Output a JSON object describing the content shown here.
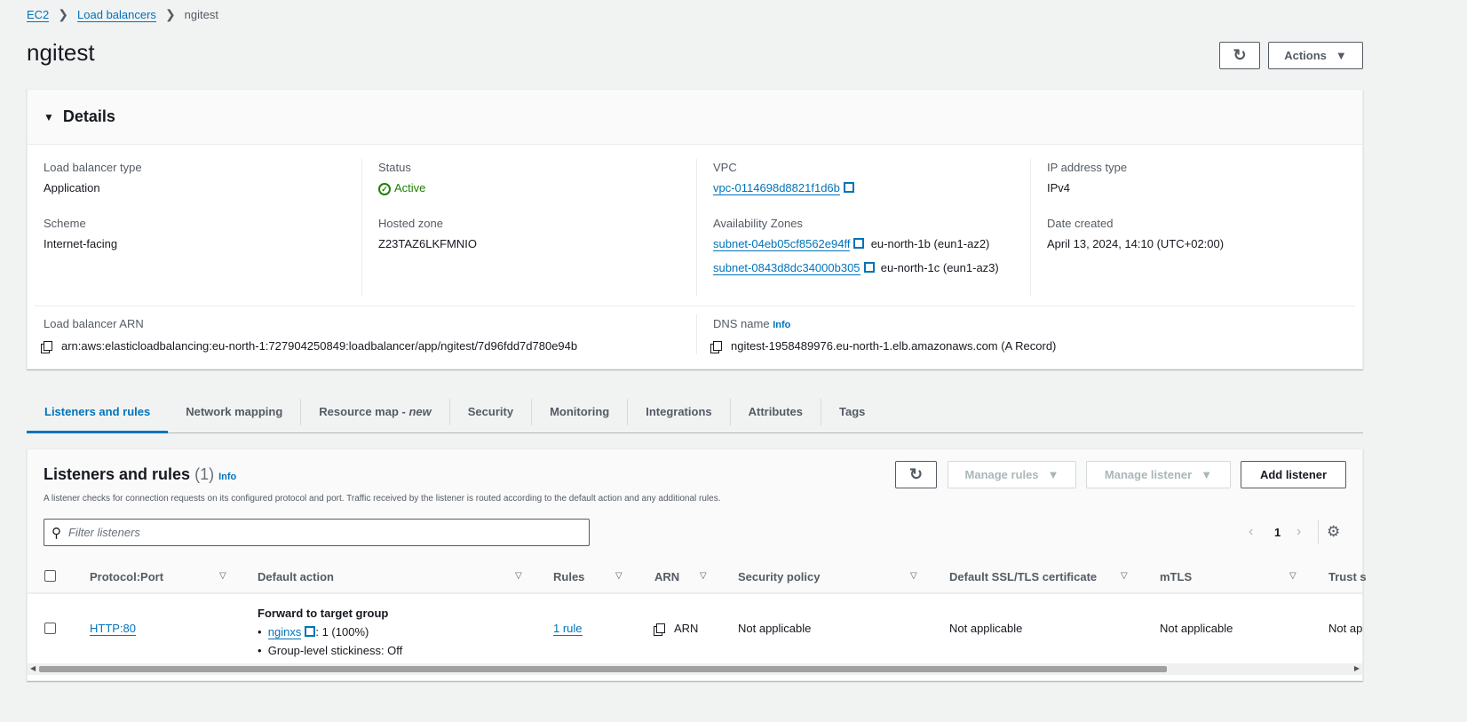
{
  "breadcrumb": [
    "EC2",
    "Load balancers",
    "ngitest"
  ],
  "title": "ngitest",
  "actions_label": "Actions",
  "details": {
    "heading": "Details",
    "lb_type_label": "Load balancer type",
    "lb_type": "Application",
    "status_label": "Status",
    "status": "Active",
    "vpc_label": "VPC",
    "vpc": "vpc-0114698d8821f1d6b",
    "ip_type_label": "IP address type",
    "ip_type": "IPv4",
    "scheme_label": "Scheme",
    "scheme": "Internet-facing",
    "hosted_zone_label": "Hosted zone",
    "hosted_zone": "Z23TAZ6LKFMNIO",
    "az_label": "Availability Zones",
    "azs": [
      {
        "subnet": "subnet-04eb05cf8562e94ff",
        "zone": "eu-north-1b (eun1-az2)"
      },
      {
        "subnet": "subnet-0843d8dc34000b305",
        "zone": "eu-north-1c (eun1-az3)"
      }
    ],
    "date_label": "Date created",
    "date": "April 13, 2024, 14:10 (UTC+02:00)",
    "arn_label": "Load balancer ARN",
    "arn": "arn:aws:elasticloadbalancing:eu-north-1:727904250849:loadbalancer/app/ngitest/7d96fdd7d780e94b",
    "dns_label": "DNS name",
    "info": "Info",
    "dns": "ngitest-1958489976.eu-north-1.elb.amazonaws.com (A Record)"
  },
  "tabs": [
    "Listeners and rules",
    "Network mapping",
    "Resource map - ",
    "Security",
    "Monitoring",
    "Integrations",
    "Attributes",
    "Tags"
  ],
  "tab_new": "new",
  "listeners": {
    "title": "Listeners and rules",
    "count": "(1)",
    "info": "Info",
    "desc": "A listener checks for connection requests on its configured protocol and port. Traffic received by the listener is routed according to the default action and any additional rules.",
    "manage_rules": "Manage rules",
    "manage_listener": "Manage listener",
    "add_listener": "Add listener",
    "filter_placeholder": "Filter listeners",
    "page": "1",
    "columns": [
      "Protocol:Port",
      "Default action",
      "Rules",
      "ARN",
      "Security policy",
      "Default SSL/TLS certificate",
      "mTLS",
      "Trust s"
    ],
    "row": {
      "protocol": "HTTP:80",
      "action_title": "Forward to target group",
      "tg": "nginxs",
      "tg_weight": ": 1 (100%)",
      "stickiness": "Group-level stickiness: Off",
      "rules": "1 rule",
      "arn": "ARN",
      "policy": "Not applicable",
      "cert": "Not applicable",
      "mtls": "Not applicable",
      "trust": "Not ap"
    }
  }
}
